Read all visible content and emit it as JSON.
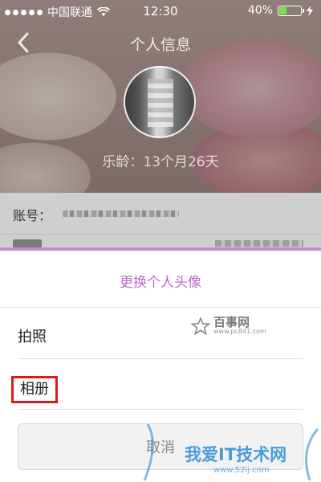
{
  "status_bar": {
    "carrier": "中国联通",
    "time": "12:30",
    "battery_percent": "40%",
    "battery_level": 0.4,
    "battery_color": "#7ddc54"
  },
  "nav": {
    "back_icon": "chevron-left-icon",
    "title": "个人信息"
  },
  "profile": {
    "age_text": "乐龄：13个月26天"
  },
  "info": {
    "account_label": "账号："
  },
  "sheet": {
    "title": "更换个人头像",
    "title_color": "#b86cc8",
    "options": [
      {
        "label": "拍照"
      },
      {
        "label": "相册",
        "highlighted": true,
        "highlight_color": "#e01818"
      }
    ],
    "cancel_label": "取消"
  },
  "watermarks": {
    "top_main": "百事网",
    "top_url": "www.pc841.com",
    "bottom_main": "我爱IT技术网",
    "bottom_url": "www.52ij.com"
  }
}
